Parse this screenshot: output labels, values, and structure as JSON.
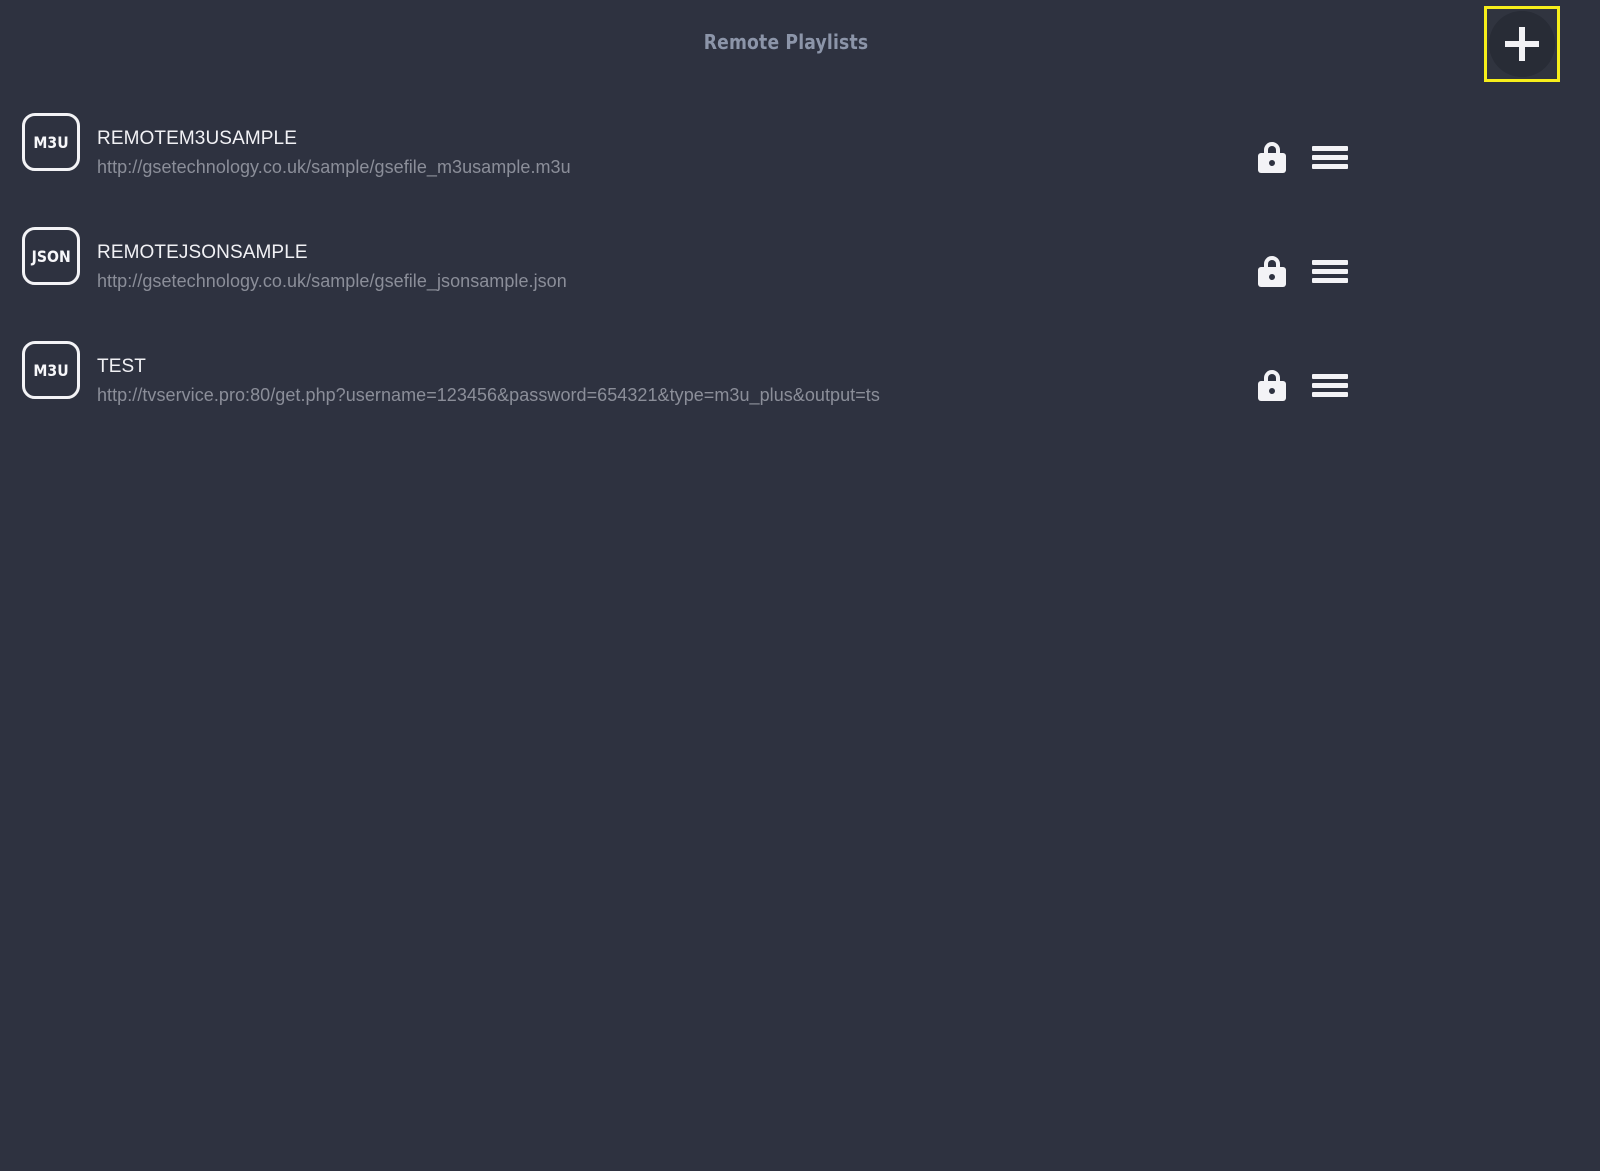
{
  "header": {
    "title": "Remote Playlists",
    "add_button": {
      "label": "+",
      "icon": "plus-icon",
      "focused": true,
      "focus_color": "#f6ee1b"
    }
  },
  "colors": {
    "background": "#2e3240",
    "title_text": "#8c95a9",
    "primary_text": "#f1f1f5",
    "secondary_text": "#8b8e99",
    "icon": "#f3f3f6",
    "focus_outline": "#f6ee1b"
  },
  "playlists": [
    {
      "type": "M3U",
      "name": "REMOTEM3USAMPLE",
      "url": "http://gsetechnology.co.uk/sample/gsefile_m3usample.m3u",
      "lock_icon": "lock-closed-icon",
      "menu_icon": "hamburger-menu-icon"
    },
    {
      "type": "JSON",
      "name": "REMOTEJSONSAMPLE",
      "url": "http://gsetechnology.co.uk/sample/gsefile_jsonsample.json",
      "lock_icon": "lock-closed-icon",
      "menu_icon": "hamburger-menu-icon"
    },
    {
      "type": "M3U",
      "name": "TEST",
      "url": "http://tvservice.pro:80/get.php?username=123456&password=654321&type=m3u_plus&output=ts",
      "lock_icon": "lock-closed-icon",
      "menu_icon": "hamburger-menu-icon"
    }
  ]
}
